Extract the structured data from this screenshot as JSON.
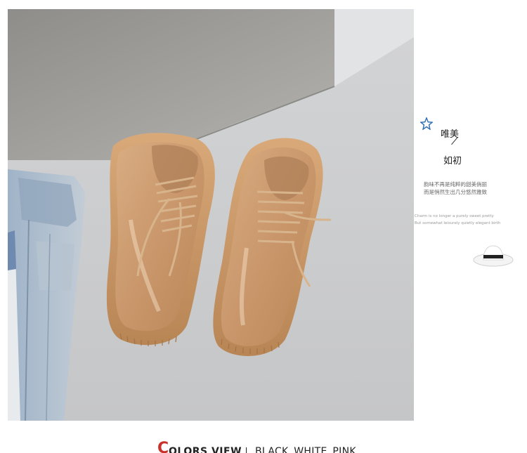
{
  "side_panel": {
    "line1": "唯美",
    "line2": "如初",
    "cn_line1": "韵味不再是纯粹的甜美俏丽",
    "cn_line2": "而是悄然生出几分悠然雅致",
    "en_line1": "Charm is no longer a purely sweet pretty",
    "en_line2": "But somewhat leisurely quietly elegant birth"
  },
  "bottom": {
    "c_letter": "C",
    "olors_view": "OLORS VIEW",
    "colors_text": "BLACK WHITE PINK"
  },
  "colors": {
    "accent_red": "#c8322a",
    "star_blue": "#2f6fb6",
    "shoe_tan": "#c99a6e",
    "floor_grey": "#c9cacc",
    "wall_grey": "#a8a7a3"
  }
}
